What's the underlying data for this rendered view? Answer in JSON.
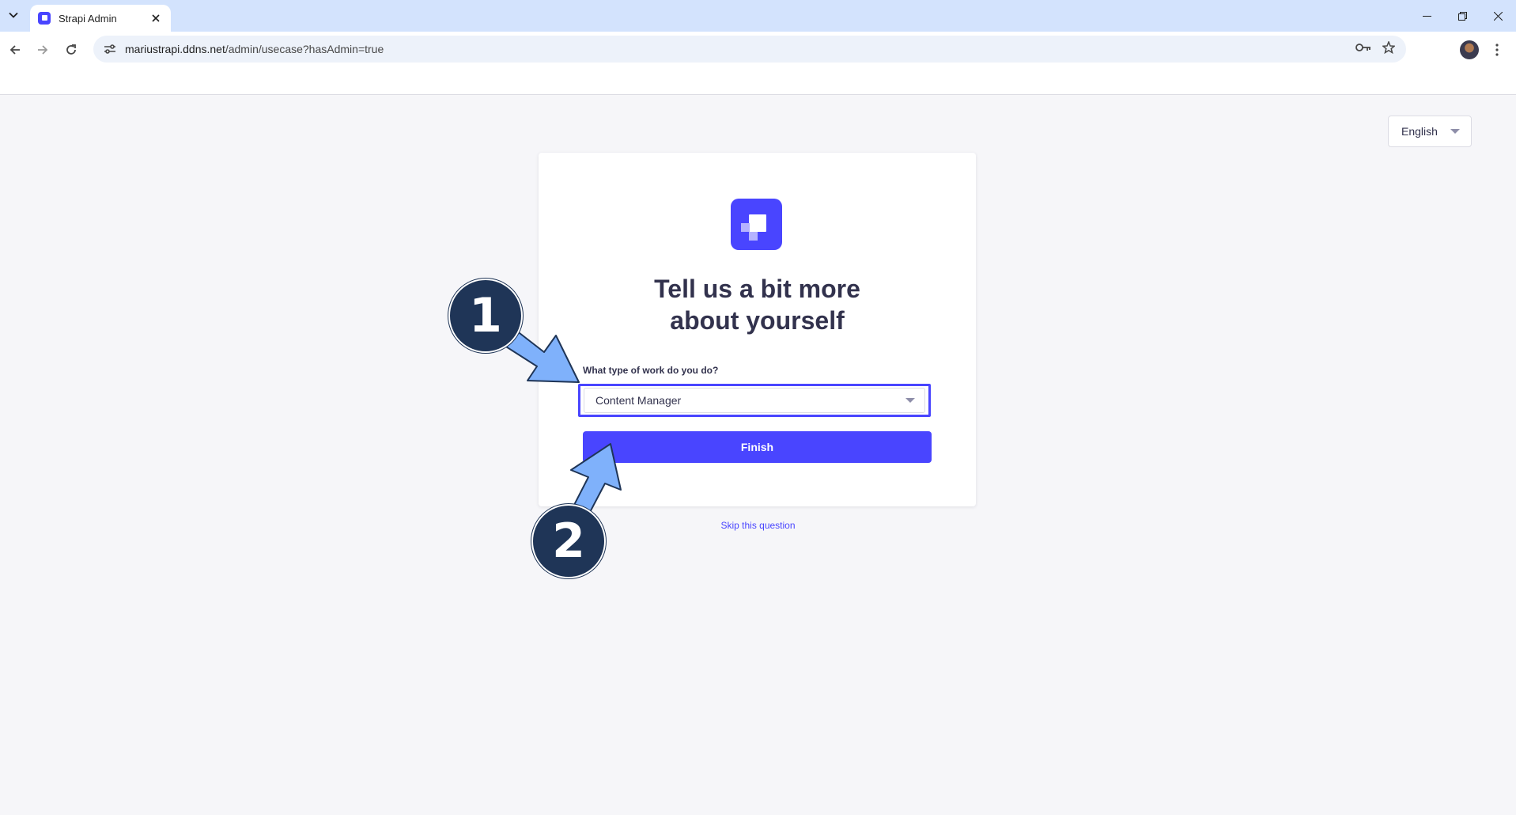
{
  "browser": {
    "tab_title": "Strapi Admin",
    "url_host": "mariustrapi.ddns.net",
    "url_path": "/admin/usecase?hasAdmin=true"
  },
  "page": {
    "language": "English",
    "heading_line1": "Tell us a bit more",
    "heading_line2": "about yourself",
    "question_label": "What type of work do you do?",
    "selected_role": "Content Manager",
    "finish_label": "Finish",
    "skip_label": "Skip this question"
  },
  "annotations": {
    "step1": "1",
    "step2": "2"
  },
  "colors": {
    "accent": "#4945ff",
    "badge": "#1f3557",
    "arrow": "#7fb1fb"
  },
  "icons": [
    "tab-list-icon",
    "close-icon",
    "minimize-icon",
    "restore-icon",
    "back-arrow-icon",
    "forward-arrow-icon",
    "reload-icon",
    "site-info-icon",
    "password-key-icon",
    "bookmark-star-icon",
    "kebab-menu-icon",
    "chevron-down-icon",
    "strapi-logo"
  ]
}
